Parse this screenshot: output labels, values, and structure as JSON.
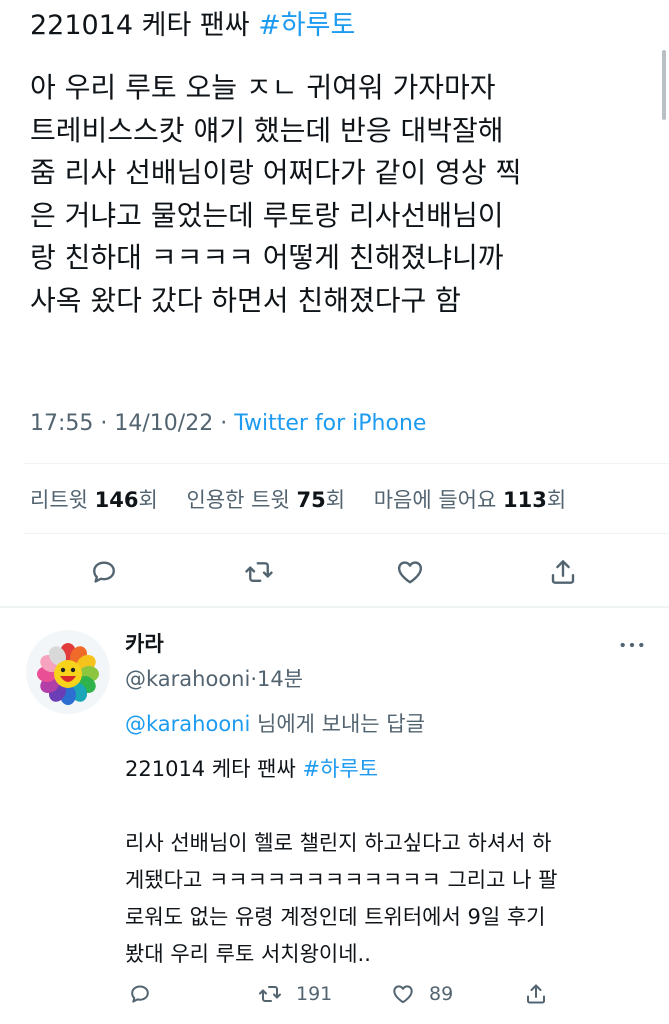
{
  "tweet": {
    "title_text": "221014 케타 팬싸 ",
    "title_hashtag": "#하루토",
    "body": "아 우리 루토 오늘 ㅈㄴ 귀여워 가자마자\n트레비스스캇 얘기 했는데 반응 대박잘해\n줌 리사 선배님이랑 어쩌다가 같이 영상 찍\n은 거냐고 물었는데 루토랑 리사선배님이\n랑 친하대 ㅋㅋㅋㅋ 어떻게 친해졌냐니까\n사옥 왔다 갔다 하면서 친해졌다구 함",
    "time": "17:55",
    "date": "14/10/22",
    "sep": " · ",
    "source": "Twitter for iPhone",
    "stats": {
      "retweet_label": "리트윗 ",
      "retweet_count": "146",
      "retweet_unit": "회",
      "quote_label": "인용한 트윗 ",
      "quote_count": "75",
      "quote_unit": "회",
      "like_label": "마음에 들어요 ",
      "like_count": "113",
      "like_unit": "회"
    },
    "actions": {
      "reply_icon": "reply-icon",
      "retweet_icon": "retweet-icon",
      "like_icon": "heart-icon",
      "share_icon": "share-icon"
    }
  },
  "reply": {
    "name": "카라",
    "handle": "@karahooni",
    "time_sep": "·",
    "time": "14분",
    "replying_mention": "@karahooni",
    "replying_suffix": " 님에게 보내는 답글",
    "title_text": "221014 케타 팬싸 ",
    "title_hashtag": "#하루토",
    "body": "리사 선배님이 헬로 챌린지 하고싶다고 하셔서 하\n게됐다고 ㅋㅋㅋㅋㅋㅋㅋㅋㅋㅋㅋㅋ 그리고 나 팔\n로워도 없는 유령 계정인데 트위터에서 9일 후기\n봤대 우리 루토 서치왕이네..",
    "retweet_count": "191",
    "like_count": "89"
  },
  "colors": {
    "link": "#1d9bf0",
    "secondary_text": "#536471",
    "primary_text": "#0f1419"
  }
}
